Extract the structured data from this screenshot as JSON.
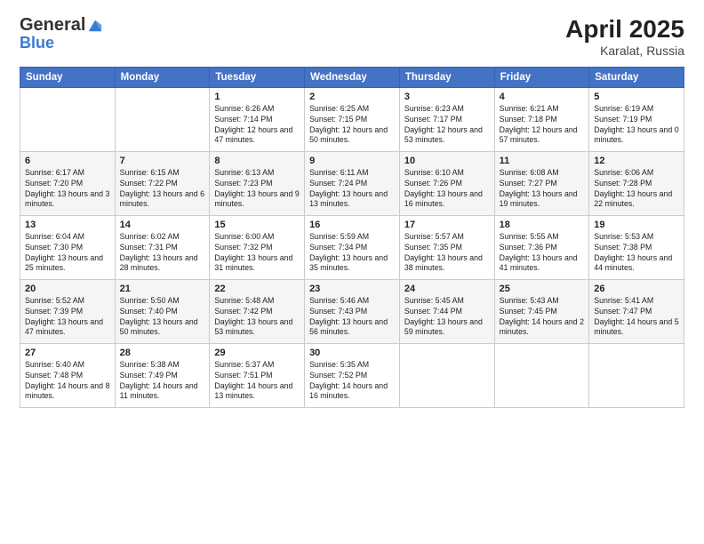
{
  "header": {
    "logo_general": "General",
    "logo_blue": "Blue",
    "title": "April 2025",
    "location": "Karalat, Russia"
  },
  "days_of_week": [
    "Sunday",
    "Monday",
    "Tuesday",
    "Wednesday",
    "Thursday",
    "Friday",
    "Saturday"
  ],
  "weeks": [
    [
      {
        "day": "",
        "info": ""
      },
      {
        "day": "",
        "info": ""
      },
      {
        "day": "1",
        "info": "Sunrise: 6:26 AM\nSunset: 7:14 PM\nDaylight: 12 hours and 47 minutes."
      },
      {
        "day": "2",
        "info": "Sunrise: 6:25 AM\nSunset: 7:15 PM\nDaylight: 12 hours and 50 minutes."
      },
      {
        "day": "3",
        "info": "Sunrise: 6:23 AM\nSunset: 7:17 PM\nDaylight: 12 hours and 53 minutes."
      },
      {
        "day": "4",
        "info": "Sunrise: 6:21 AM\nSunset: 7:18 PM\nDaylight: 12 hours and 57 minutes."
      },
      {
        "day": "5",
        "info": "Sunrise: 6:19 AM\nSunset: 7:19 PM\nDaylight: 13 hours and 0 minutes."
      }
    ],
    [
      {
        "day": "6",
        "info": "Sunrise: 6:17 AM\nSunset: 7:20 PM\nDaylight: 13 hours and 3 minutes."
      },
      {
        "day": "7",
        "info": "Sunrise: 6:15 AM\nSunset: 7:22 PM\nDaylight: 13 hours and 6 minutes."
      },
      {
        "day": "8",
        "info": "Sunrise: 6:13 AM\nSunset: 7:23 PM\nDaylight: 13 hours and 9 minutes."
      },
      {
        "day": "9",
        "info": "Sunrise: 6:11 AM\nSunset: 7:24 PM\nDaylight: 13 hours and 13 minutes."
      },
      {
        "day": "10",
        "info": "Sunrise: 6:10 AM\nSunset: 7:26 PM\nDaylight: 13 hours and 16 minutes."
      },
      {
        "day": "11",
        "info": "Sunrise: 6:08 AM\nSunset: 7:27 PM\nDaylight: 13 hours and 19 minutes."
      },
      {
        "day": "12",
        "info": "Sunrise: 6:06 AM\nSunset: 7:28 PM\nDaylight: 13 hours and 22 minutes."
      }
    ],
    [
      {
        "day": "13",
        "info": "Sunrise: 6:04 AM\nSunset: 7:30 PM\nDaylight: 13 hours and 25 minutes."
      },
      {
        "day": "14",
        "info": "Sunrise: 6:02 AM\nSunset: 7:31 PM\nDaylight: 13 hours and 28 minutes."
      },
      {
        "day": "15",
        "info": "Sunrise: 6:00 AM\nSunset: 7:32 PM\nDaylight: 13 hours and 31 minutes."
      },
      {
        "day": "16",
        "info": "Sunrise: 5:59 AM\nSunset: 7:34 PM\nDaylight: 13 hours and 35 minutes."
      },
      {
        "day": "17",
        "info": "Sunrise: 5:57 AM\nSunset: 7:35 PM\nDaylight: 13 hours and 38 minutes."
      },
      {
        "day": "18",
        "info": "Sunrise: 5:55 AM\nSunset: 7:36 PM\nDaylight: 13 hours and 41 minutes."
      },
      {
        "day": "19",
        "info": "Sunrise: 5:53 AM\nSunset: 7:38 PM\nDaylight: 13 hours and 44 minutes."
      }
    ],
    [
      {
        "day": "20",
        "info": "Sunrise: 5:52 AM\nSunset: 7:39 PM\nDaylight: 13 hours and 47 minutes."
      },
      {
        "day": "21",
        "info": "Sunrise: 5:50 AM\nSunset: 7:40 PM\nDaylight: 13 hours and 50 minutes."
      },
      {
        "day": "22",
        "info": "Sunrise: 5:48 AM\nSunset: 7:42 PM\nDaylight: 13 hours and 53 minutes."
      },
      {
        "day": "23",
        "info": "Sunrise: 5:46 AM\nSunset: 7:43 PM\nDaylight: 13 hours and 56 minutes."
      },
      {
        "day": "24",
        "info": "Sunrise: 5:45 AM\nSunset: 7:44 PM\nDaylight: 13 hours and 59 minutes."
      },
      {
        "day": "25",
        "info": "Sunrise: 5:43 AM\nSunset: 7:45 PM\nDaylight: 14 hours and 2 minutes."
      },
      {
        "day": "26",
        "info": "Sunrise: 5:41 AM\nSunset: 7:47 PM\nDaylight: 14 hours and 5 minutes."
      }
    ],
    [
      {
        "day": "27",
        "info": "Sunrise: 5:40 AM\nSunset: 7:48 PM\nDaylight: 14 hours and 8 minutes."
      },
      {
        "day": "28",
        "info": "Sunrise: 5:38 AM\nSunset: 7:49 PM\nDaylight: 14 hours and 11 minutes."
      },
      {
        "day": "29",
        "info": "Sunrise: 5:37 AM\nSunset: 7:51 PM\nDaylight: 14 hours and 13 minutes."
      },
      {
        "day": "30",
        "info": "Sunrise: 5:35 AM\nSunset: 7:52 PM\nDaylight: 14 hours and 16 minutes."
      },
      {
        "day": "",
        "info": ""
      },
      {
        "day": "",
        "info": ""
      },
      {
        "day": "",
        "info": ""
      }
    ]
  ]
}
